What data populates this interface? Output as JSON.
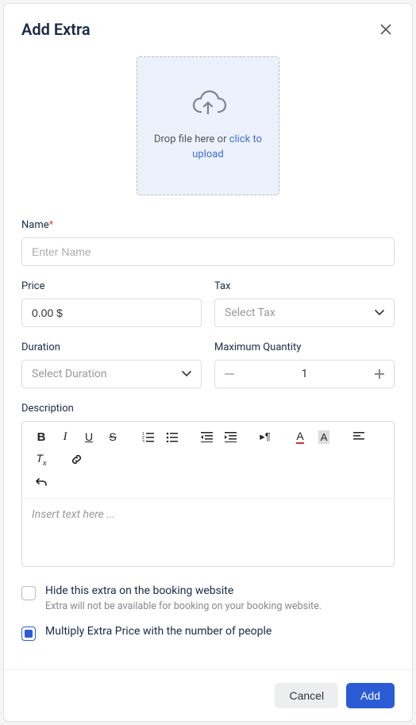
{
  "header": {
    "title": "Add Extra"
  },
  "upload": {
    "text_prefix": "Drop file here or ",
    "link_text": "click to upload"
  },
  "fields": {
    "name": {
      "label": "Name",
      "placeholder": "Enter Name",
      "required": "*"
    },
    "price": {
      "label": "Price",
      "value": "0.00 $"
    },
    "tax": {
      "label": "Tax",
      "placeholder": "Select Tax"
    },
    "duration": {
      "label": "Duration",
      "placeholder": "Select Duration"
    },
    "max_qty": {
      "label": "Maximum Quantity",
      "value": "1"
    },
    "description": {
      "label": "Description",
      "placeholder": "Insert text here ..."
    }
  },
  "options": {
    "hide": {
      "label": "Hide this extra on the booking website",
      "sub": "Extra will not be available for booking on your booking website."
    },
    "multiply": {
      "label": "Multiply Extra Price with the number of people"
    }
  },
  "footer": {
    "cancel": "Cancel",
    "add": "Add"
  }
}
